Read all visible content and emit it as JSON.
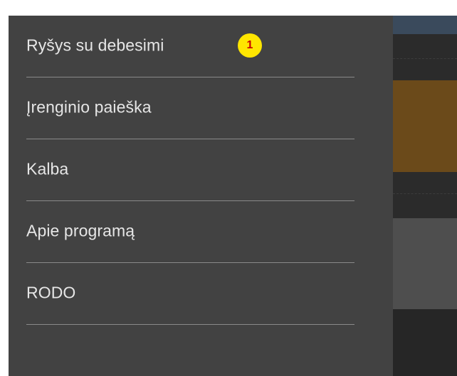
{
  "drawer": {
    "items": [
      {
        "label": "Ryšys su debesimi"
      },
      {
        "label": "Įrenginio paieška"
      },
      {
        "label": "Kalba"
      },
      {
        "label": "Apie programą"
      },
      {
        "label": "RODO"
      }
    ]
  },
  "annotation": {
    "badge_number": "1"
  },
  "colors": {
    "drawer_bg": "#424242",
    "divider": "#8a8a8a",
    "text": "#e6e6e6",
    "badge_bg": "#ffe600",
    "badge_text": "#c80000",
    "background_accent": "#6b4a1a"
  }
}
